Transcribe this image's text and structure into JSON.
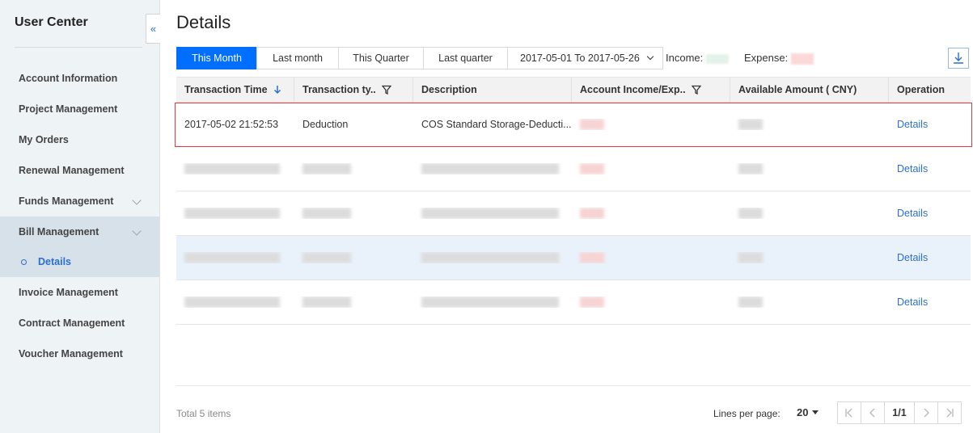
{
  "sidebar": {
    "title": "User Center",
    "items": [
      {
        "label": "Account Information"
      },
      {
        "label": "Project Management"
      },
      {
        "label": "My Orders"
      },
      {
        "label": "Renewal Management"
      },
      {
        "label": "Funds Management"
      },
      {
        "label": "Bill Management"
      },
      {
        "label": "Details"
      },
      {
        "label": "Invoice Management"
      },
      {
        "label": "Contract Management"
      },
      {
        "label": "Voucher Management"
      }
    ]
  },
  "main": {
    "title": "Details",
    "tabs": [
      "This Month",
      "Last month",
      "This Quarter",
      "Last quarter"
    ],
    "date_range": "2017-05-01 To 2017-05-26",
    "income_label": "Income:",
    "expense_label": "Expense:",
    "table": {
      "headers": [
        "Transaction Time",
        "Transaction ty..",
        "Description",
        "Account Income/Exp..",
        "Available Amount ( CNY)",
        "Operation"
      ],
      "row1": {
        "time": "2017-05-02 21:52:53",
        "type": "Deduction",
        "description": "COS Standard Storage-Deducti..."
      },
      "operation_label": "Details"
    },
    "footer": {
      "total": "Total 5 items",
      "lines_per_page_label": "Lines per page:",
      "lines_per_page_value": "20",
      "page_indicator": "1/1"
    }
  },
  "colors": {
    "accent": "#006eff",
    "link": "#2b6fcf",
    "highlight_row": "#e9f1fb",
    "selection_border": "#e03b3b"
  }
}
